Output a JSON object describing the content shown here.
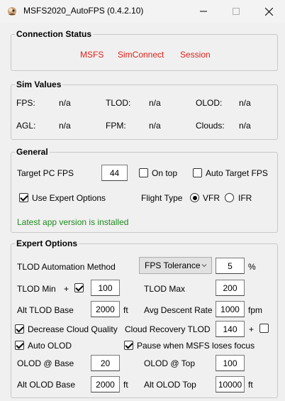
{
  "window": {
    "title": "MSFS2020_AutoFPS (0.4.2.10)"
  },
  "connection_status": {
    "legend": "Connection Status",
    "items": [
      "MSFS",
      "SimConnect",
      "Session"
    ],
    "status_color": "#e0201a"
  },
  "sim_values": {
    "legend": "Sim Values",
    "fps_label": "FPS:",
    "fps_value": "n/a",
    "tlod_label": "TLOD:",
    "tlod_value": "n/a",
    "olod_label": "OLOD:",
    "olod_value": "n/a",
    "agl_label": "AGL:",
    "agl_value": "n/a",
    "fpm_label": "FPM:",
    "fpm_value": "n/a",
    "clouds_label": "Clouds:",
    "clouds_value": "n/a"
  },
  "general": {
    "legend": "General",
    "target_fps_label": "Target PC FPS",
    "target_fps_value": "44",
    "on_top_label": "On top",
    "on_top_checked": false,
    "auto_target_label": "Auto Target FPS",
    "auto_target_checked": false,
    "expert_options_label": "Use Expert Options",
    "expert_options_checked": true,
    "flight_type_label": "Flight Type",
    "vfr_label": "VFR",
    "ifr_label": "IFR",
    "flight_type_selected": "VFR",
    "version_message": "Latest app version is installed",
    "version_color": "#1f8a1f"
  },
  "expert": {
    "legend": "Expert Options",
    "tlod_method_label": "TLOD Automation Method",
    "tlod_method_value": "FPS Tolerance",
    "tolerance_value": "5",
    "tolerance_unit": "%",
    "tlod_min_label": "TLOD Min",
    "tlod_min_plus": "+",
    "tlod_min_checked": true,
    "tlod_min_value": "100",
    "tlod_max_label": "TLOD Max",
    "tlod_max_value": "200",
    "alt_tlod_base_label": "Alt TLOD Base",
    "alt_tlod_base_value": "2000",
    "alt_tlod_base_unit": "ft",
    "avg_descent_label": "Avg Descent Rate",
    "avg_descent_value": "1000",
    "avg_descent_unit": "fpm",
    "decrease_cloud_label": "Decrease Cloud Quality",
    "decrease_cloud_checked": true,
    "cloud_recovery_label": "Cloud Recovery TLOD",
    "cloud_recovery_value": "140",
    "cloud_recovery_plus": "+",
    "cloud_recovery_plus_checked": false,
    "auto_olod_label": "Auto OLOD",
    "auto_olod_checked": true,
    "pause_label": "Pause when MSFS loses focus",
    "pause_checked": true,
    "olod_base_label": "OLOD @ Base",
    "olod_base_value": "20",
    "olod_top_label": "OLOD @ Top",
    "olod_top_value": "100",
    "alt_olod_base_label": "Alt OLOD Base",
    "alt_olod_base_value": "2000",
    "alt_olod_base_unit": "ft",
    "alt_olod_top_label": "Alt OLOD Top",
    "alt_olod_top_value": "10000",
    "alt_olod_top_unit": "ft"
  },
  "icons": {
    "app": "app-logo-icon",
    "minimize": "minimize-icon",
    "maximize": "maximize-icon",
    "close": "close-icon",
    "dropdown": "chevron-down-icon"
  }
}
